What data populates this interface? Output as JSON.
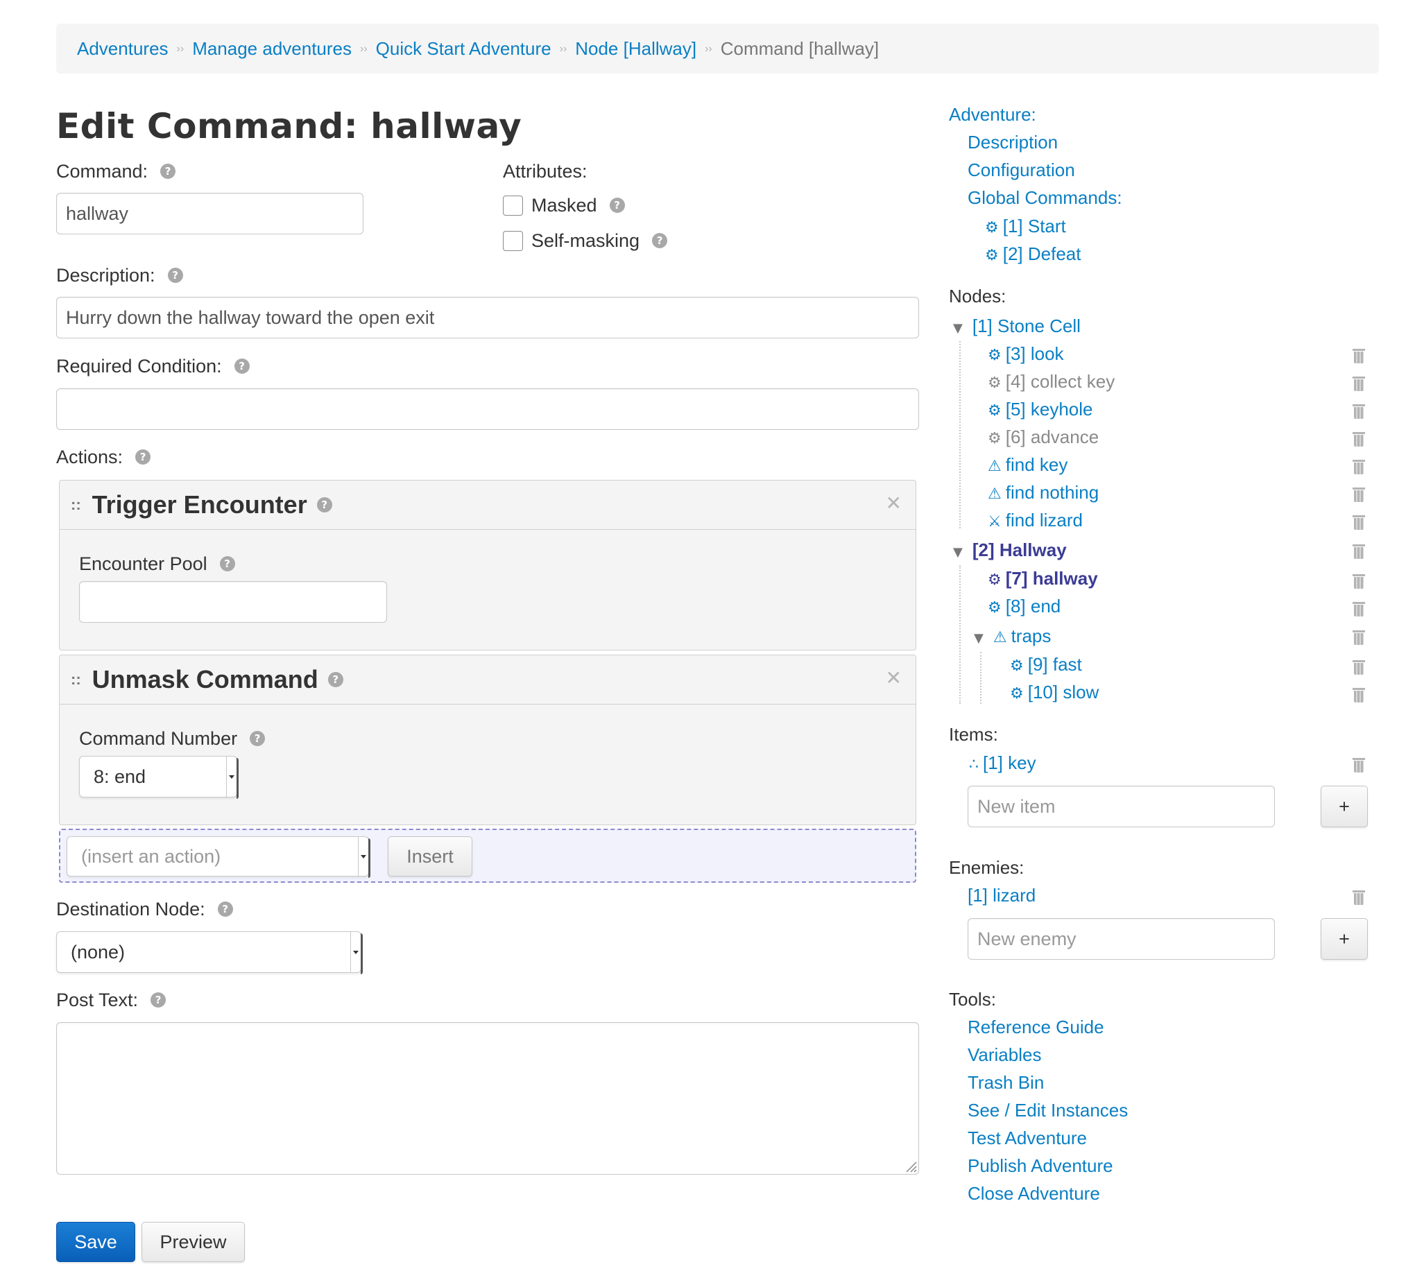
{
  "breadcrumb": {
    "items": [
      "Adventures",
      "Manage adventures",
      "Quick Start Adventure",
      "Node [Hallway]"
    ],
    "current": "Command [hallway]",
    "separator": "››"
  },
  "page_title": "Edit Command: hallway",
  "form": {
    "command_label": "Command:",
    "command_value": "hallway",
    "attributes_label": "Attributes:",
    "masked_label": "Masked",
    "self_masking_label": "Self-masking",
    "description_label": "Description:",
    "description_value": "Hurry down the hallway toward the open exit",
    "required_condition_label": "Required Condition:",
    "required_condition_value": "",
    "actions_label": "Actions:",
    "destination_label": "Destination Node:",
    "destination_value": "(none)",
    "post_text_label": "Post Text:",
    "post_text_value": ""
  },
  "actions": [
    {
      "title": "Trigger Encounter",
      "field_label": "Encounter Pool",
      "field_value": ""
    },
    {
      "title": "Unmask Command",
      "field_label": "Command Number",
      "field_value": "8: end"
    }
  ],
  "insert": {
    "placeholder": "(insert an action)",
    "button": "Insert"
  },
  "buttons": {
    "save": "Save",
    "preview": "Preview"
  },
  "sidebar": {
    "adventure_label": "Adventure:",
    "description": "Description",
    "configuration": "Configuration",
    "global_commands_label": "Global Commands:",
    "global_commands": [
      "[1] Start",
      "[2] Defeat"
    ],
    "nodes_label": "Nodes:",
    "node1": {
      "title": "[1] Stone Cell",
      "children": [
        {
          "icon": "⚙",
          "label": "[3] look",
          "state": "normal"
        },
        {
          "icon": "⚙",
          "label": "[4] collect key",
          "state": "muted"
        },
        {
          "icon": "⚙",
          "label": "[5] keyhole",
          "state": "normal"
        },
        {
          "icon": "⚙",
          "label": "[6] advance",
          "state": "muted"
        },
        {
          "icon": "⚠",
          "label": "find key",
          "state": "normal"
        },
        {
          "icon": "⚠",
          "label": "find nothing",
          "state": "normal"
        },
        {
          "icon": "⚔",
          "label": "find lizard",
          "state": "normal"
        }
      ]
    },
    "node2": {
      "title": "[2] Hallway",
      "children": [
        {
          "icon": "⚙",
          "label": "[7] hallway",
          "state": "active"
        },
        {
          "icon": "⚙",
          "label": "[8] end",
          "state": "normal"
        }
      ],
      "group": {
        "title": "traps",
        "children": [
          "[9] fast",
          "[10] slow"
        ]
      }
    },
    "items_label": "Items:",
    "items": [
      "[1] key"
    ],
    "new_item_placeholder": "New item",
    "enemies_label": "Enemies:",
    "enemies": [
      "[1] lizard"
    ],
    "new_enemy_placeholder": "New enemy",
    "add_button": "+",
    "tools_label": "Tools:",
    "tools": [
      "Reference Guide",
      "Variables",
      "Trash Bin",
      "See / Edit Instances",
      "Test Adventure",
      "Publish Adventure",
      "Close Adventure"
    ]
  }
}
